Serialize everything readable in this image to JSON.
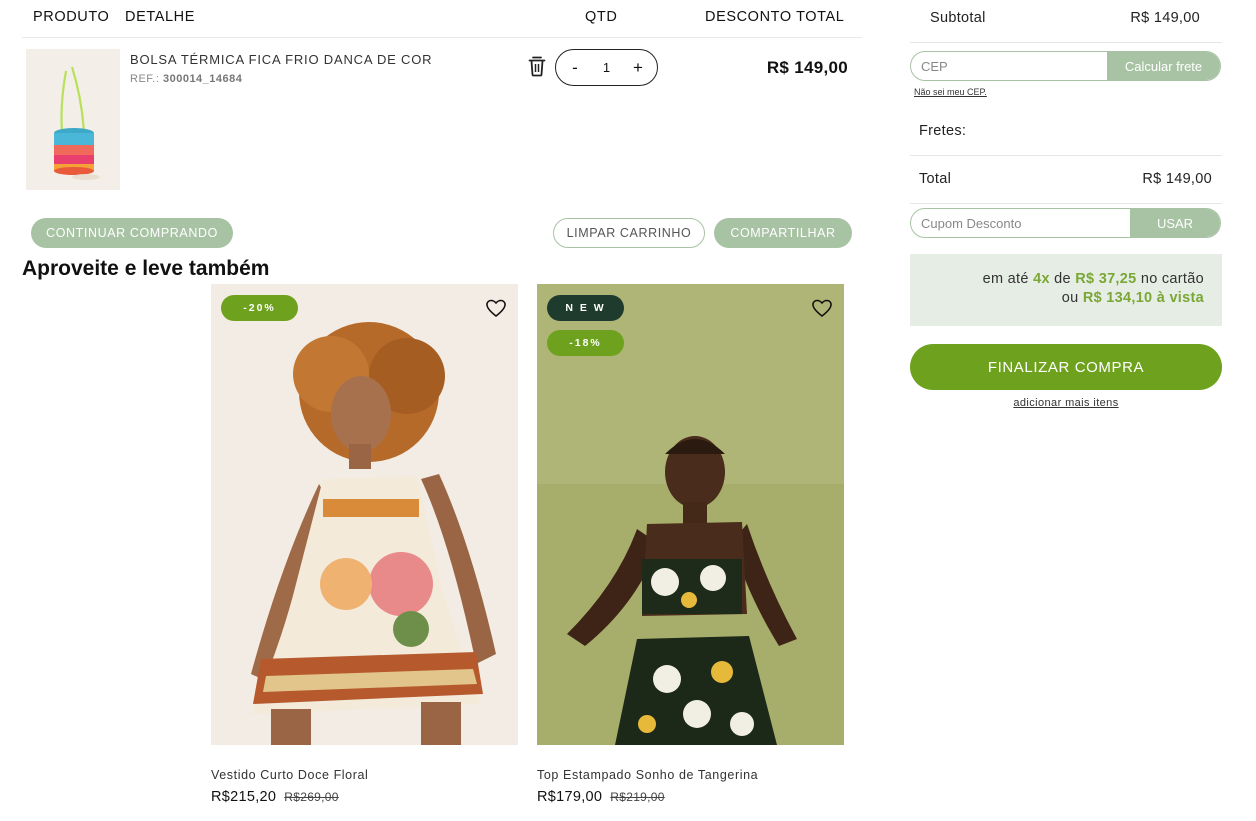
{
  "cart": {
    "headers": {
      "product": "PRODUTO",
      "detail": "DETALHE",
      "qty": "QTD",
      "total": "DESCONTO TOTAL"
    },
    "item": {
      "name": "BOLSA TÉRMICA FICA FRIO DANCA DE COR",
      "ref_label": "REF.:",
      "ref_code": "300014_14684",
      "quantity": "1",
      "minus": "-",
      "plus": "+",
      "price": "R$ 149,00"
    },
    "buttons": {
      "continue": "CONTINUAR COMPRANDO",
      "clear": "LIMPAR CARRINHO",
      "share": "COMPARTILHAR"
    }
  },
  "upsell": {
    "title": "Aproveite e leve também",
    "products": [
      {
        "name": "Vestido Curto Doce Floral",
        "price": "R$215,20",
        "old_price": "R$269,00",
        "badges": [
          "-20%"
        ]
      },
      {
        "name": "Top Estampado Sonho de Tangerina",
        "price": "R$179,00",
        "old_price": "R$219,00",
        "badges": [
          "N E W",
          "-18%"
        ]
      }
    ]
  },
  "summary": {
    "subtotal_label": "Subtotal",
    "subtotal_value": "R$ 149,00",
    "cep_placeholder": "CEP",
    "cep_button": "Calcular frete",
    "cep_help": "Não sei meu CEP.",
    "shipping_label": "Fretes:",
    "total_label": "Total",
    "total_value": "R$ 149,00",
    "coupon_placeholder": "Cupom Desconto",
    "coupon_button": "USAR",
    "installments": {
      "prefix": "em até",
      "count": "4x",
      "of": "de",
      "amount": "R$ 37,25",
      "suffix": "no cartão",
      "or": "ou",
      "cash": "R$ 134,10 à vista"
    },
    "checkout": "FINALIZAR COMPRA",
    "add_more": "adicionar mais itens"
  },
  "colors": {
    "accent_green": "#6ea21e",
    "soft_green": "#a8c3a4",
    "badge_green": "#6ea21e",
    "badge_dark": "#1f3b2e",
    "installment_bg": "#e6ede5"
  }
}
